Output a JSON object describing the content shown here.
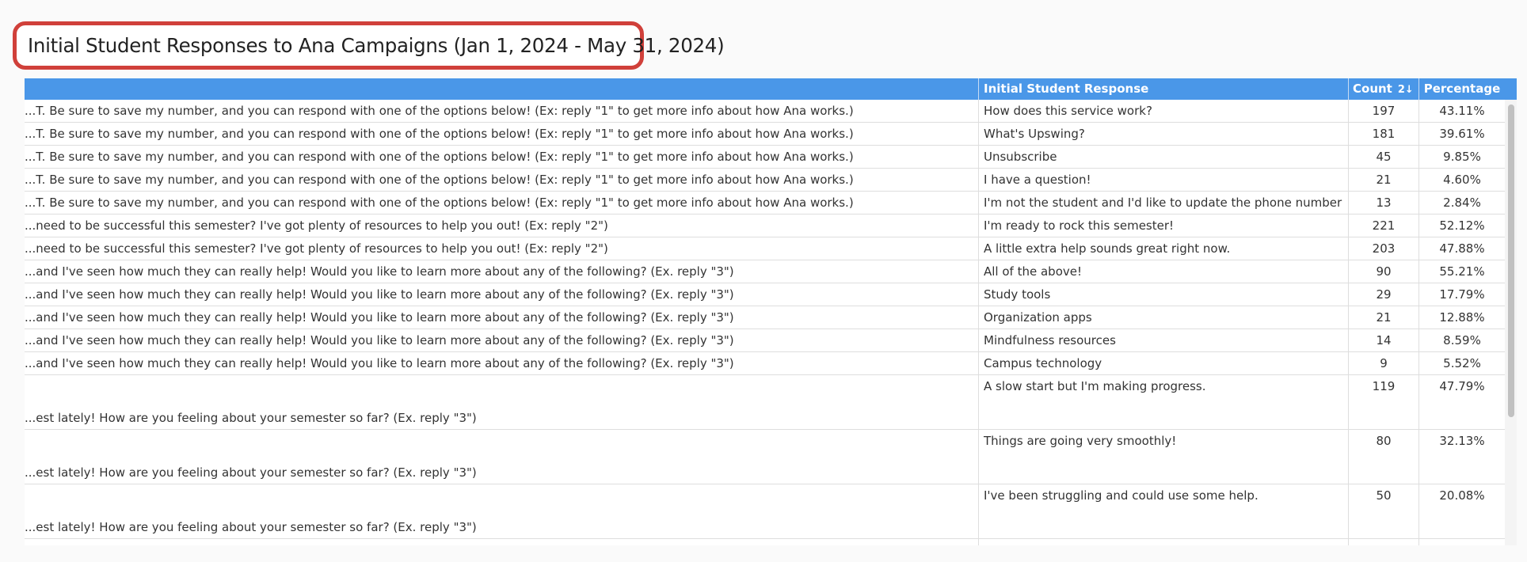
{
  "title": "Initial Student Responses to Ana Campaigns (Jan 1, 2024 - May 31, 2024)",
  "table": {
    "columns": {
      "message": "",
      "response": "Initial Student Response",
      "count": "Count",
      "sort_indicator": "2↓",
      "percentage": "Percentage"
    },
    "rows": [
      {
        "message": "...T. Be sure to save my number, and you can respond with one of the options below! (Ex: reply \"1\" to get more info about how Ana works.)",
        "response": "How does this service work?",
        "count": "197",
        "percentage": "43.11%"
      },
      {
        "message": "...T. Be sure to save my number, and you can respond with one of the options below! (Ex: reply \"1\" to get more info about how Ana works.)",
        "response": "What's Upswing?",
        "count": "181",
        "percentage": "39.61%"
      },
      {
        "message": "...T. Be sure to save my number, and you can respond with one of the options below! (Ex: reply \"1\" to get more info about how Ana works.)",
        "response": "Unsubscribe",
        "count": "45",
        "percentage": "9.85%"
      },
      {
        "message": "...T. Be sure to save my number, and you can respond with one of the options below! (Ex: reply \"1\" to get more info about how Ana works.)",
        "response": "I have a question!",
        "count": "21",
        "percentage": "4.60%"
      },
      {
        "message": "...T. Be sure to save my number, and you can respond with one of the options below! (Ex: reply \"1\" to get more info about how Ana works.)",
        "response": "I'm not the student and I'd like to update the phone number",
        "count": "13",
        "percentage": "2.84%"
      },
      {
        "message": "...need to be successful this semester? I've got plenty of resources to help you out! (Ex: reply \"2\")",
        "response": "I'm ready to rock this semester!",
        "count": "221",
        "percentage": "52.12%"
      },
      {
        "message": "...need to be successful this semester? I've got plenty of resources to help you out! (Ex: reply \"2\")",
        "response": "A little extra help sounds great right now.",
        "count": "203",
        "percentage": "47.88%"
      },
      {
        "message": "...and I've seen how much they can really help! Would you like to learn more about any of the following? (Ex. reply \"3\")",
        "response": "All of the above!",
        "count": "90",
        "percentage": "55.21%"
      },
      {
        "message": "...and I've seen how much they can really help! Would you like to learn more about any of the following? (Ex. reply \"3\")",
        "response": "Study tools",
        "count": "29",
        "percentage": "17.79%"
      },
      {
        "message": "...and I've seen how much they can really help! Would you like to learn more about any of the following? (Ex. reply \"3\")",
        "response": "Organization apps",
        "count": "21",
        "percentage": "12.88%"
      },
      {
        "message": "...and I've seen how much they can really help! Would you like to learn more about any of the following? (Ex. reply \"3\")",
        "response": "Mindfulness resources",
        "count": "14",
        "percentage": "8.59%"
      },
      {
        "message": "...and I've seen how much they can really help! Would you like to learn more about any of the following? (Ex. reply \"3\")",
        "response": "Campus technology",
        "count": "9",
        "percentage": "5.52%"
      },
      {
        "message": "...est lately! How are you feeling about your semester so far? (Ex. reply \"3\")",
        "response": "A slow start but I'm making progress.",
        "count": "119",
        "percentage": "47.79%"
      },
      {
        "message": "...est lately! How are you feeling about your semester so far? (Ex. reply \"3\")",
        "response": "Things are going very smoothly!",
        "count": "80",
        "percentage": "32.13%"
      },
      {
        "message": "...est lately! How are you feeling about your semester so far? (Ex. reply \"3\")",
        "response": "I've been struggling and could use some help.",
        "count": "50",
        "percentage": "20.08%"
      }
    ]
  }
}
